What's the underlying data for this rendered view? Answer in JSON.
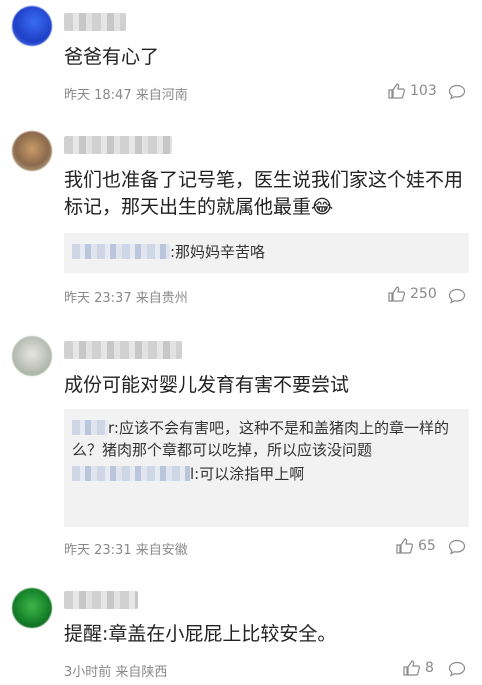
{
  "comments": [
    {
      "text": "爸爸有心了",
      "time": "昨天 18:47",
      "location": "来自河南",
      "likes": "103",
      "replies": []
    },
    {
      "text": "我们也准备了记号笔，医生说我们家这个娃不用标记，那天出生的就属他最重😂",
      "time": "昨天 23:37",
      "location": "来自贵州",
      "likes": "250",
      "replies": [
        {
          "text": ":那妈妈辛苦咯"
        }
      ]
    },
    {
      "text": "成份可能对婴儿发育有害不要尝试",
      "time": "昨天 23:31",
      "location": "来自安徽",
      "likes": "65",
      "replies": [
        {
          "text": "r:应该不会有害吧，这种不是和盖猪肉上的章一样的么？猪肉那个章都可以吃掉，所以应该没问题"
        },
        {
          "text": "l:可以涂指甲上啊"
        }
      ]
    },
    {
      "text": "提醒:章盖在小屁屁上比较安全。",
      "time": "3小时前",
      "location": "来自陕西",
      "likes": "8",
      "replies": []
    }
  ],
  "icons": {
    "like": "thumbs-up-icon",
    "reply": "speech-bubble-icon"
  },
  "colors": {
    "meta": "#8a8a8a",
    "reply_bg": "#f2f2f2"
  }
}
